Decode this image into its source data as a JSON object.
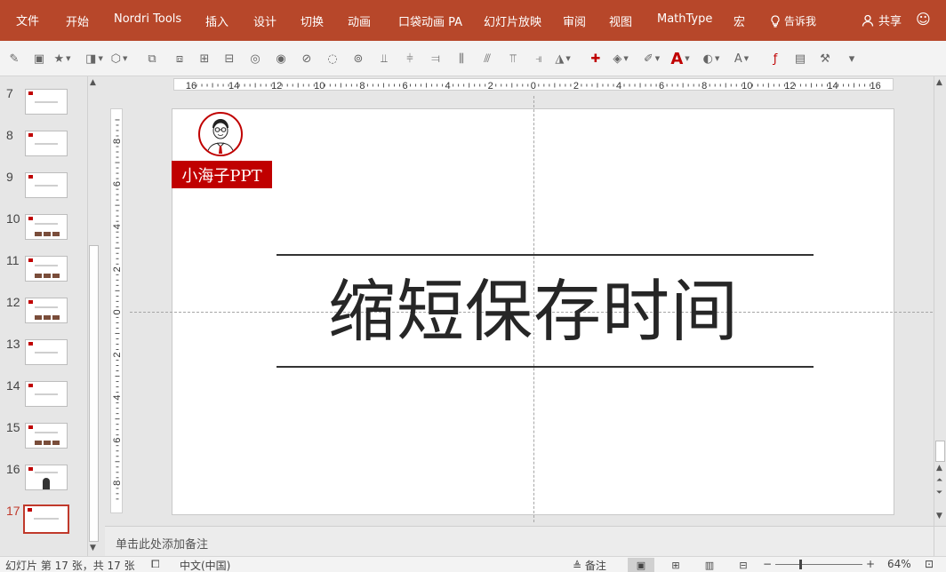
{
  "ribbon": {
    "tabs": [
      "文件",
      "开始",
      "Nordri Tools",
      "插入",
      "设计",
      "切换",
      "动画",
      "口袋动画 PA",
      "幻灯片放映",
      "审阅",
      "视图",
      "MathType",
      "宏"
    ],
    "tell_me": "告诉我",
    "share": "共享"
  },
  "toolbar": {
    "icons": [
      "format-painter-icon",
      "picture-icon",
      "star-icon",
      "shape-icon",
      "shape-fill-icon",
      "group-icon",
      "ungroup-icon",
      "bring-forward-icon",
      "send-backward-icon",
      "union-icon",
      "combine-icon",
      "fragment-icon",
      "intersect-icon",
      "subtract-icon",
      "align-bottom-icon",
      "align-center-icon",
      "align-right-icon",
      "distribute-h-icon",
      "distribute-v-icon",
      "align-top-icon",
      "align-left-icon",
      "rotate-icon",
      "puzzle-icon",
      "fill-bucket-icon",
      "pen-icon",
      "font-color-icon",
      "eraser-icon",
      "text-effect-icon",
      "flash-icon",
      "toolbox-icon",
      "tools-icon",
      "more-icon"
    ]
  },
  "thumbnails": [
    {
      "num": "7",
      "active": false,
      "kind": "text"
    },
    {
      "num": "8",
      "active": false,
      "kind": "text"
    },
    {
      "num": "9",
      "active": false,
      "kind": "text"
    },
    {
      "num": "10",
      "active": false,
      "kind": "images"
    },
    {
      "num": "11",
      "active": false,
      "kind": "images"
    },
    {
      "num": "12",
      "active": false,
      "kind": "images"
    },
    {
      "num": "13",
      "active": false,
      "kind": "text"
    },
    {
      "num": "14",
      "active": false,
      "kind": "text"
    },
    {
      "num": "15",
      "active": false,
      "kind": "images"
    },
    {
      "num": "16",
      "active": false,
      "kind": "figure"
    },
    {
      "num": "17",
      "active": true,
      "kind": "text"
    }
  ],
  "ruler": {
    "h_labels": [
      "16",
      "14",
      "12",
      "10",
      "8",
      "6",
      "4",
      "2",
      "0",
      "2",
      "4",
      "6",
      "8",
      "10",
      "12",
      "14",
      "16"
    ],
    "v_labels": [
      "8",
      "6",
      "4",
      "2",
      "0",
      "2",
      "4",
      "6",
      "8"
    ]
  },
  "slide": {
    "brand": "小海子PPT",
    "title": "缩短保存时间"
  },
  "notes": {
    "placeholder": "单击此处添加备注"
  },
  "status": {
    "slide_info": "幻灯片 第 17 张，共 17 张",
    "language": "中文(中国)",
    "notes_btn": "备注",
    "zoom": "64%"
  },
  "colors": {
    "ribbon": "#b7472a",
    "brand": "#c00000",
    "active_thumb": "#c0392b"
  }
}
